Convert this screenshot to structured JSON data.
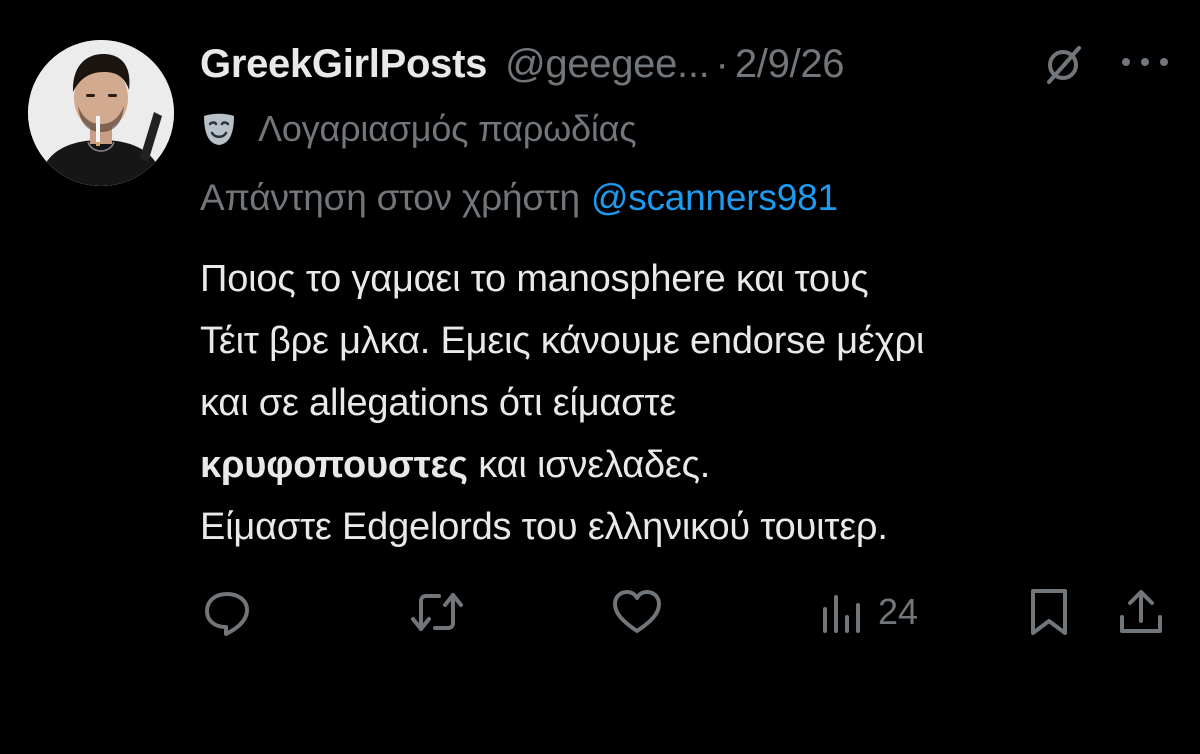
{
  "author": {
    "display_name": "GreekGirlPosts",
    "handle": "@geegee...",
    "separator": "·",
    "date": "2/9/26",
    "avatar_icon": "avatar-photo"
  },
  "labels": {
    "parody_icon": "theater-mask-icon",
    "parody_text": "Λογαριασμός παρωδίας"
  },
  "reply": {
    "prefix": "Απάντηση στον χρήστη",
    "user": "@scanners981"
  },
  "body": {
    "line1": "Ποιος το γαμαει το manosphere και τους",
    "line2": "Τέιτ βρε μλκα. Εμεις κάνουμε endorse μέχρι",
    "line3": "και σε allegations ότι είμαστε",
    "line4_bold": "κρυφοπουστες",
    "line4_rest": " και ισνελαδες.",
    "line5": "Είμαστε Edgelords του ελληνικού τουιτερ."
  },
  "actions": {
    "reply_icon": "reply-icon",
    "retweet_icon": "retweet-icon",
    "like_icon": "heart-icon",
    "views_icon": "views-icon",
    "views_count": "24",
    "bookmark_icon": "bookmark-icon",
    "share_icon": "share-icon"
  },
  "colors": {
    "background": "#000000",
    "primary_text": "#e7e9ea",
    "secondary_text": "#71767b",
    "link": "#1d9bf0"
  }
}
